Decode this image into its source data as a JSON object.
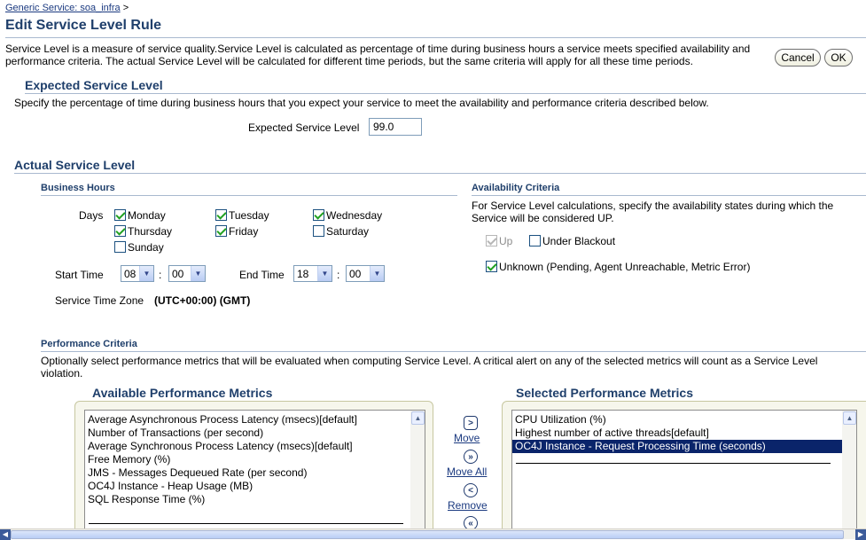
{
  "breadcrumb": {
    "link": "Generic Service: soa_infra",
    "separator": ">"
  },
  "page_title": "Edit Service Level Rule",
  "description": "Service Level is a measure of service quality.Service Level is calculated as percentage of time during business hours a service meets specified availability and performance criteria. The actual Service Level will be calculated for different time periods, but the same criteria will apply for all these time periods.",
  "buttons": {
    "cancel": "Cancel",
    "ok": "OK"
  },
  "expected": {
    "heading": "Expected Service Level",
    "instructions": "Specify the percentage of time during business hours that you expect your service to meet the availability and performance criteria described below.",
    "field_label": "Expected Service Level",
    "field_value": "99.0"
  },
  "actual": {
    "heading": "Actual Service Level",
    "business_hours": {
      "heading": "Business Hours",
      "days_label": "Days",
      "days": [
        {
          "label": "Monday",
          "checked": true
        },
        {
          "label": "Tuesday",
          "checked": true
        },
        {
          "label": "Wednesday",
          "checked": true
        },
        {
          "label": "Thursday",
          "checked": true
        },
        {
          "label": "Friday",
          "checked": true
        },
        {
          "label": "Saturday",
          "checked": false
        },
        {
          "label": "Sunday",
          "checked": false
        }
      ],
      "start_label": "Start Time",
      "start_hour": "08",
      "start_minute": "00",
      "end_label": "End Time",
      "end_hour": "18",
      "end_minute": "00",
      "time_sep": ":",
      "tz_label": "Service Time Zone",
      "tz_value": "(UTC+00:00) (GMT)"
    },
    "availability": {
      "heading": "Availability Criteria",
      "instructions": "For Service Level calculations, specify the availability states during which the Service will be considered UP.",
      "up": "Up",
      "blackout": "Under Blackout",
      "unknown": "Unknown (Pending, Agent Unreachable, Metric Error)"
    }
  },
  "performance": {
    "heading": "Performance Criteria",
    "instructions": "Optionally select performance metrics that will be evaluated when computing Service Level. A critical alert on any of the selected metrics will count as a Service Level violation.",
    "available_heading": "Available Performance Metrics",
    "selected_heading": "Selected Performance Metrics",
    "available": [
      "Average Asynchronous Process Latency (msecs)[default]",
      "Number of Transactions (per second)",
      "Average Synchronous Process Latency (msecs)[default]",
      "Free Memory (%)",
      "JMS - Messages Dequeued Rate (per second)",
      "OC4J Instance - Heap Usage (MB)",
      "SQL Response Time (%)"
    ],
    "selected": [
      "CPU Utilization (%)",
      "Highest number of active threads[default]",
      "OC4J Instance - Request Processing Time (seconds)"
    ],
    "move": "Move",
    "move_all": "Move All",
    "remove": "Remove"
  },
  "colors": {
    "heading": "#1f3f6b",
    "selection": "#0a246a",
    "rule": "#a9b9cf"
  }
}
